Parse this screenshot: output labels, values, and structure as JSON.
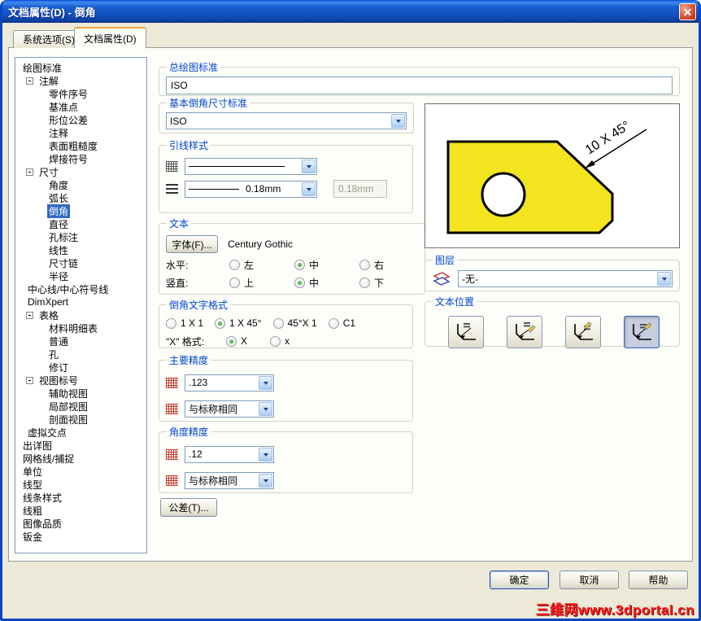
{
  "window": {
    "title": "文档属性(D) - 倒角"
  },
  "tabs": {
    "system": "系统选项(S)",
    "document": "文档属性(D)"
  },
  "tree": {
    "items": [
      {
        "label": "绘图标准",
        "level": 0
      },
      {
        "label": "注解",
        "level": 1,
        "expander": "-"
      },
      {
        "label": "零件序号",
        "level": 2
      },
      {
        "label": "基准点",
        "level": 2
      },
      {
        "label": "形位公差",
        "level": 2
      },
      {
        "label": "注释",
        "level": 2
      },
      {
        "label": "表面粗糙度",
        "level": 2
      },
      {
        "label": "焊接符号",
        "level": 2
      },
      {
        "label": "尺寸",
        "level": 1,
        "expander": "-"
      },
      {
        "label": "角度",
        "level": 2
      },
      {
        "label": "弧长",
        "level": 2
      },
      {
        "label": "倒角",
        "level": 2,
        "selected": true
      },
      {
        "label": "直径",
        "level": 2
      },
      {
        "label": "孔标注",
        "level": 2
      },
      {
        "label": "线性",
        "level": 2
      },
      {
        "label": "尺寸链",
        "level": 2
      },
      {
        "label": "半径",
        "level": 2
      },
      {
        "label": "中心线/中心符号线",
        "level": 1
      },
      {
        "label": "DimXpert",
        "level": 1
      },
      {
        "label": "表格",
        "level": 1,
        "expander": "-"
      },
      {
        "label": "材料明细表",
        "level": 2
      },
      {
        "label": "普通",
        "level": 2
      },
      {
        "label": "孔",
        "level": 2
      },
      {
        "label": "修订",
        "level": 2
      },
      {
        "label": "视图标号",
        "level": 1,
        "expander": "-"
      },
      {
        "label": "辅助视图",
        "level": 2
      },
      {
        "label": "局部视图",
        "level": 2
      },
      {
        "label": "剖面视图",
        "level": 2
      },
      {
        "label": "虚拟交点",
        "level": 1
      },
      {
        "label": "出详图",
        "level": 0
      },
      {
        "label": "网格线/捕捉",
        "level": 0
      },
      {
        "label": "单位",
        "level": 0
      },
      {
        "label": "线型",
        "level": 0
      },
      {
        "label": "线条样式",
        "level": 0
      },
      {
        "label": "线粗",
        "level": 0
      },
      {
        "label": "图像品质",
        "level": 0
      },
      {
        "label": "钣金",
        "level": 0
      }
    ]
  },
  "groups": {
    "overall": {
      "legend": "总绘图标准",
      "value": "ISO"
    },
    "base": {
      "legend": "基本倒角尺寸标准",
      "value": "ISO"
    },
    "leader": {
      "legend": "引线样式",
      "thickness_label": "0.18mm",
      "thickness_box": "0.18mm"
    },
    "text": {
      "legend": "文本",
      "font_button": "字体(F)...",
      "font_name": "Century Gothic",
      "horizontal_label": "水平:",
      "vertical_label": "竖直:",
      "h_options": [
        {
          "label": "左",
          "selected": false
        },
        {
          "label": "中",
          "selected": true
        },
        {
          "label": "右",
          "selected": false
        }
      ],
      "v_options": [
        {
          "label": "上",
          "selected": false
        },
        {
          "label": "中",
          "selected": true
        },
        {
          "label": "下",
          "selected": false
        }
      ]
    },
    "chamfer_format": {
      "legend": "倒角文字格式",
      "options": [
        {
          "label": "1 X 1",
          "selected": false
        },
        {
          "label": "1 X 45°",
          "selected": true
        },
        {
          "label": "45°X 1",
          "selected": false
        },
        {
          "label": "C1",
          "selected": false
        }
      ],
      "x_label": "\"X\" 格式:",
      "x_options": [
        {
          "label": "X",
          "selected": true
        },
        {
          "label": "x",
          "selected": false
        }
      ]
    },
    "primary_precision": {
      "legend": "主要精度",
      "value1": ".123",
      "value2": "与标称相同"
    },
    "angle_precision": {
      "legend": "角度精度",
      "value1": ".12",
      "value2": "与标称相同"
    },
    "layer": {
      "legend": "图层",
      "value": "-无-"
    },
    "text_position": {
      "legend": "文本位置"
    }
  },
  "buttons": {
    "tolerance": "公差(T)...",
    "ok": "确定",
    "cancel": "取消",
    "help": "帮助"
  },
  "preview": {
    "annotation": "10 X 45°"
  },
  "watermark": "三维网www.3dportal.cn"
}
